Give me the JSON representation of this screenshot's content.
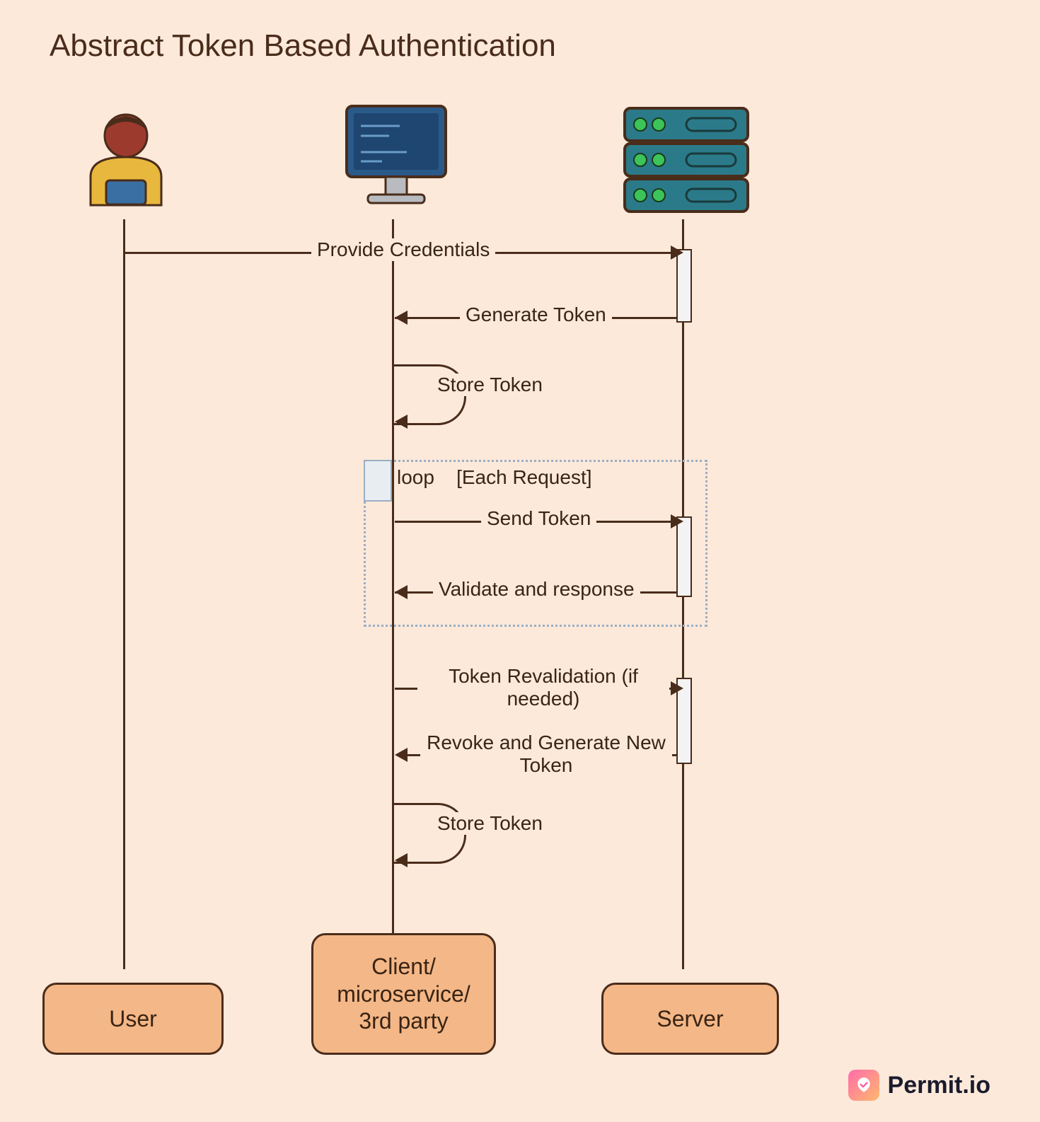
{
  "title": "Abstract Token Based Authentication",
  "actors": {
    "user": "User",
    "client": "Client/\nmicroservice/\n3rd party",
    "server": "Server"
  },
  "messages": {
    "m1": "Provide Credentials",
    "m2": "Generate Token",
    "m3": "Store Token",
    "m4": "Send Token",
    "m5": "Validate and response",
    "m6": "Token Revalidation (if needed)",
    "m7": "Revoke and Generate New Token",
    "m8": "Store Token"
  },
  "loop": {
    "keyword": "loop",
    "condition": "[Each Request]"
  },
  "brand": "Permit.io",
  "chart_data": {
    "type": "sequence-diagram",
    "title": "Abstract Token Based Authentication",
    "participants": [
      "User",
      "Client/microservice/3rd party",
      "Server"
    ],
    "steps": [
      {
        "from": "User",
        "to": "Server",
        "label": "Provide Credentials",
        "direction": "right"
      },
      {
        "from": "Server",
        "to": "Client/microservice/3rd party",
        "label": "Generate Token",
        "direction": "left"
      },
      {
        "from": "Client/microservice/3rd party",
        "to": "Client/microservice/3rd party",
        "label": "Store Token",
        "self": true
      },
      {
        "from": "Client/microservice/3rd party",
        "to": "Server",
        "label": "Send Token",
        "direction": "right",
        "group": "loop"
      },
      {
        "from": "Server",
        "to": "Client/microservice/3rd party",
        "label": "Validate and response",
        "direction": "left",
        "group": "loop"
      },
      {
        "from": "Client/microservice/3rd party",
        "to": "Server",
        "label": "Token Revalidation (if needed)",
        "direction": "right"
      },
      {
        "from": "Server",
        "to": "Client/microservice/3rd party",
        "label": "Revoke and Generate New Token",
        "direction": "left"
      },
      {
        "from": "Client/microservice/3rd party",
        "to": "Client/microservice/3rd party",
        "label": "Store Token",
        "self": true
      }
    ],
    "fragments": [
      {
        "type": "loop",
        "label": "loop",
        "condition": "[Each Request]",
        "covers_steps": [
          3,
          4
        ]
      }
    ]
  }
}
